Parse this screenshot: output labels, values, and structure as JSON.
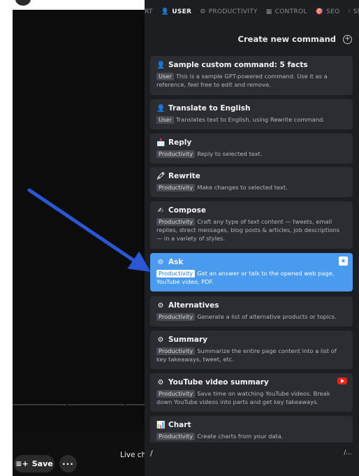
{
  "tabs": [
    {
      "label": "RT",
      "icon": "",
      "active": false
    },
    {
      "label": "USER",
      "icon": "person-icon",
      "glyph": "👤",
      "active": true
    },
    {
      "label": "PRODUCTIVITY",
      "icon": "gear-icon",
      "glyph": "⚙",
      "active": false
    },
    {
      "label": "CONTROL",
      "icon": "grid-icon",
      "glyph": "▦",
      "active": false
    },
    {
      "label": "SEO",
      "icon": "target-icon",
      "glyph": "🎯",
      "active": false
    },
    {
      "label": "SMM",
      "icon": "hash-icon",
      "glyph": "⁝",
      "active": false
    }
  ],
  "create": {
    "label": "Create new command",
    "icon": "plus-circle-icon"
  },
  "commands": [
    {
      "title": "Sample custom command: 5 facts",
      "glyph": "👤",
      "icon": "person-icon",
      "badge": "User",
      "desc": "This is a sample GPT-powered command. Use it as a reference, feel free to edit and remove."
    },
    {
      "title": "Translate to English",
      "glyph": "👤",
      "icon": "person-icon",
      "badge": "User",
      "desc": "Translates text to English, using Rewrite command."
    },
    {
      "title": "Reply",
      "glyph": "📩",
      "icon": "envelope-icon",
      "badge": "Productivity",
      "desc": "Reply to selected text."
    },
    {
      "title": "Rewrite",
      "glyph": "🖍",
      "icon": "pencil-icon",
      "badge": "Productivity",
      "desc": "Make changes to selected text."
    },
    {
      "title": "Compose",
      "glyph": "✍",
      "icon": "compose-icon",
      "badge": "Productivity",
      "desc": "Craft any type of text content — tweets, email replies, direct messages, blog posts & articles, job descriptions — in a variety of styles."
    },
    {
      "title": "Ask",
      "glyph": "⚙",
      "icon": "gear-icon",
      "badge": "Productivity",
      "desc": "Get an answer or talk to the opened web page, YouTube video, PDF."
    },
    {
      "title": "Alternatives",
      "glyph": "⚙",
      "icon": "gear-icon",
      "badge": "Productivity",
      "desc": "Generate a list of alternative products or topics."
    },
    {
      "title": "Summary",
      "glyph": "⚙",
      "icon": "gear-icon",
      "badge": "Productivity",
      "desc": "Summarize the entire page content into a list of key takeaways, tweet, etc."
    },
    {
      "title": "YouTube video summary",
      "glyph": "⚙",
      "icon": "gear-icon",
      "badge": "Productivity",
      "desc": "Save time on watching YouTube videos. Break down YouTube videos into parts and get key takeaways."
    },
    {
      "title": "Chart",
      "glyph": "📊",
      "icon": "chart-icon",
      "badge": "Productivity",
      "desc": "Create charts from your data."
    }
  ],
  "input": {
    "value": "/",
    "hint": "/..."
  },
  "video": {
    "save_label": "Save",
    "more_label": "···",
    "live_chat": "Live cha"
  },
  "colors": {
    "panel_bg": "#1d1e22",
    "card_bg": "#2c2d32",
    "selected": "#4a9bf0",
    "arrow": "#2b56d4"
  }
}
